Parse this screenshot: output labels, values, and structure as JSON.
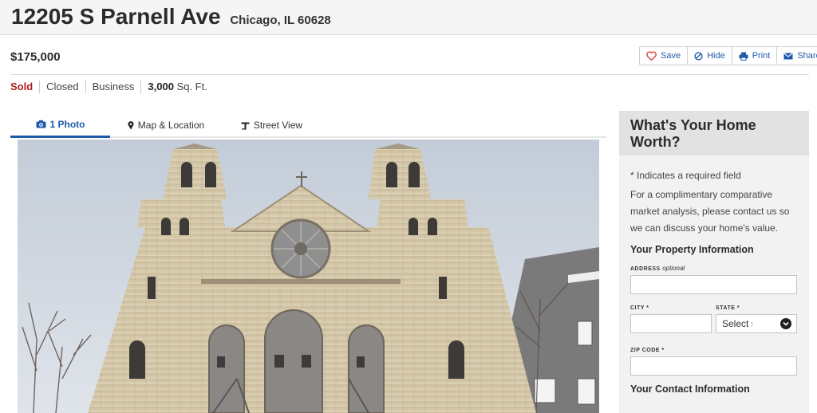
{
  "header": {
    "address": "12205 S Parnell Ave",
    "city_state_zip": "Chicago, IL 60628"
  },
  "listing": {
    "price": "$175,000",
    "status": "Sold",
    "status_items": [
      "Closed",
      "Business"
    ],
    "sqft_value": "3,000",
    "sqft_unit": "Sq. Ft."
  },
  "actions": [
    {
      "label": "Save",
      "icon": "heart-icon"
    },
    {
      "label": "Hide",
      "icon": "ban-icon"
    },
    {
      "label": "Print",
      "icon": "printer-icon"
    },
    {
      "label": "Share",
      "icon": "envelope-icon"
    }
  ],
  "tabs": [
    {
      "label": "1 Photo",
      "icon": "camera-icon",
      "active": true
    },
    {
      "label": "Map & Location",
      "icon": "map-pin-icon",
      "active": false
    },
    {
      "label": "Street View",
      "icon": "street-view-icon",
      "active": false
    }
  ],
  "form": {
    "title": "What's Your Home Worth?",
    "required_note": "* Indicates a required field",
    "description": "For a complimentary comparative market analysis, please contact us so we can discuss your home's value.",
    "property_section": "Your Property Information",
    "address_label": "ADDRESS",
    "address_optional": "optional",
    "city_label": "CITY *",
    "state_label": "STATE *",
    "state_value": "Select s",
    "zip_label": "ZIP CODE *",
    "contact_section": "Your Contact Information"
  },
  "colors": {
    "accent": "#1f5aa8",
    "sold": "#b01e1e",
    "heart": "#d0302f"
  }
}
